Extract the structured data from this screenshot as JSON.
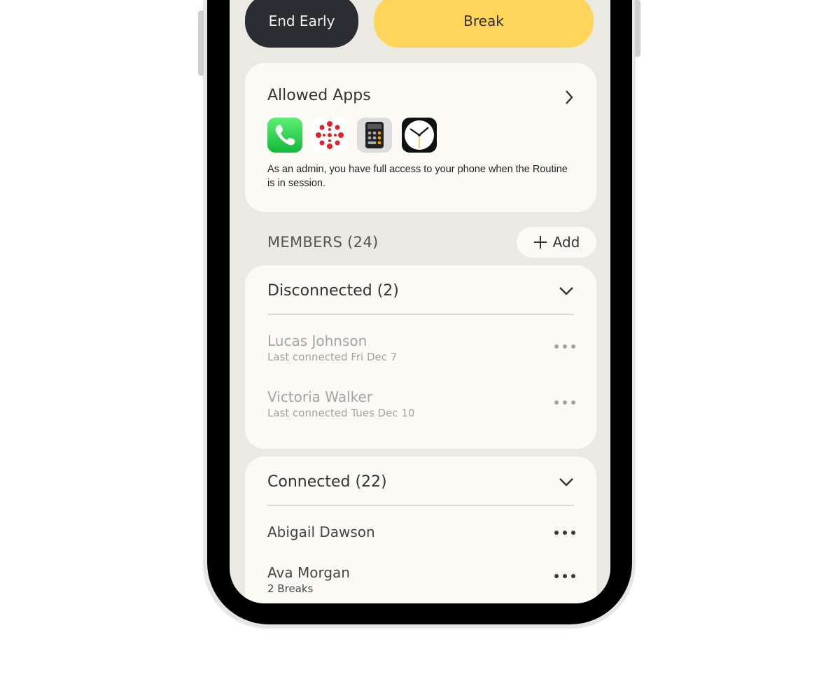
{
  "actions": {
    "end_early": "End Early",
    "break": "Break"
  },
  "allowed_apps": {
    "title": "Allowed Apps",
    "apps": [
      {
        "icon": "phone-app-icon"
      },
      {
        "icon": "canvas-app-icon"
      },
      {
        "icon": "calculator-app-icon"
      },
      {
        "icon": "clock-app-icon"
      }
    ],
    "description": "As an admin, you have full access to your phone when the Routine is in session."
  },
  "members": {
    "label": "MEMBERS (24)",
    "add_label": "Add",
    "groups": [
      {
        "title": "Disconnected (2)",
        "items": [
          {
            "name": "Lucas Johnson",
            "sub": "Last connected Fri Dec 7"
          },
          {
            "name": "Victoria Walker",
            "sub": "Last connected Tues Dec 10"
          }
        ]
      },
      {
        "title": "Connected (22)",
        "items": [
          {
            "name": "Abigail Dawson",
            "sub": ""
          },
          {
            "name": "Ava Morgan",
            "sub": "2 Breaks"
          }
        ]
      }
    ]
  },
  "colors": {
    "accent": "#ffd65a",
    "dark_button": "#2b2d33",
    "background": "#eae9e2",
    "card": "#fbfaf5"
  }
}
